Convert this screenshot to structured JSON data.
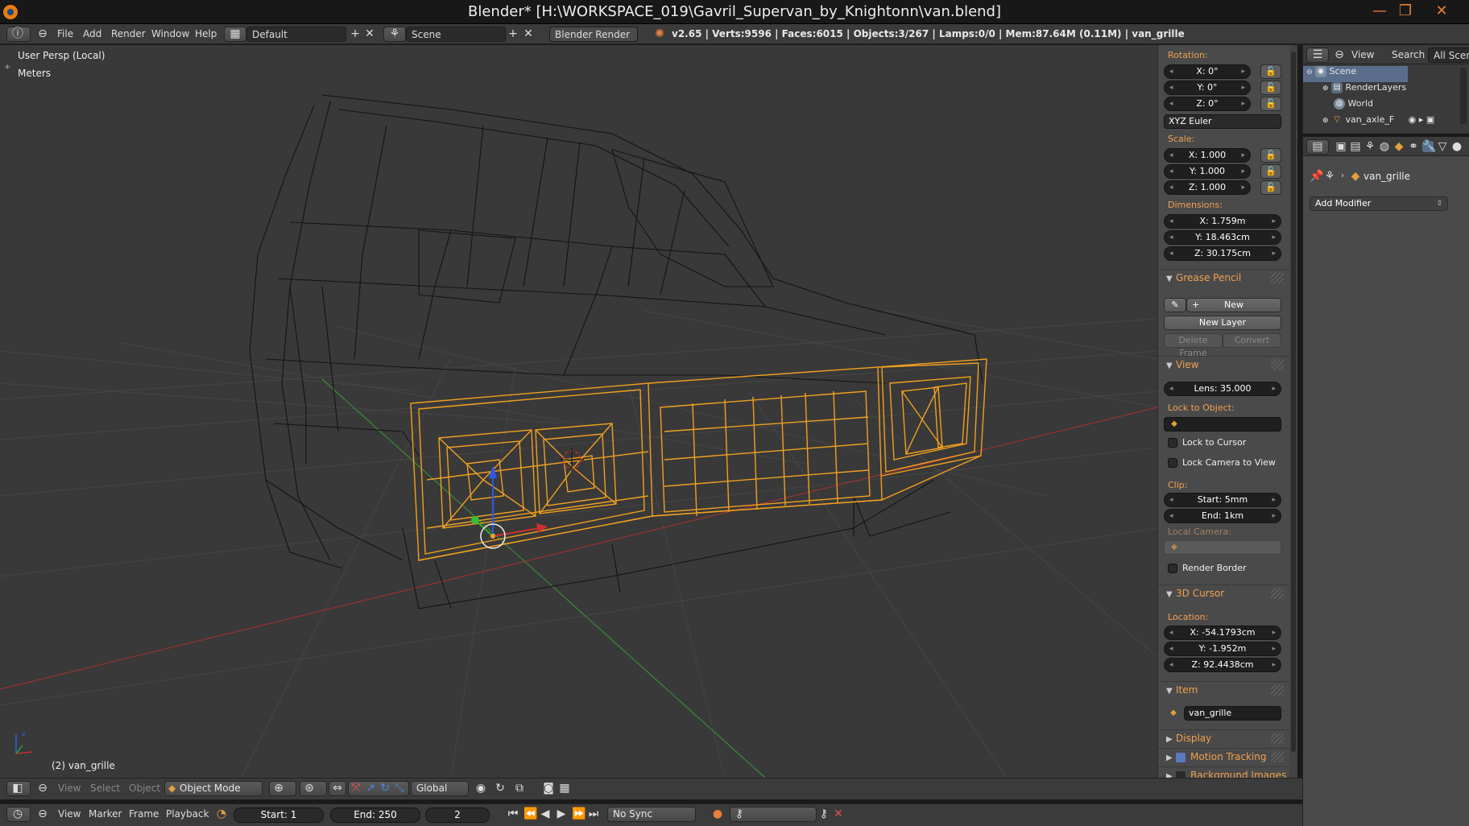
{
  "window": {
    "title": "Blender* [H:\\WORKSPACE_019\\Gavril_Supervan_by_Knightonn\\van.blend]",
    "minimize": "—",
    "maximize": "❐",
    "close": "✕"
  },
  "infobar": {
    "menus": [
      "File",
      "Add",
      "Render",
      "Window",
      "Help"
    ],
    "layout": "Default",
    "scene": "Scene",
    "engine": "Blender Render",
    "stats": "v2.65 | Verts:9596 | Faces:6015 | Objects:3/267 | Lamps:0/0 | Mem:87.64M (0.11M) | van_grille"
  },
  "viewport": {
    "view_name": "User Persp (Local)",
    "units": "Meters",
    "object_label": "(2) van_grille",
    "colors": {
      "selected": "#f0a020",
      "wire": "#111111",
      "grid": "#4a4a4a",
      "x_axis": "#a03030",
      "y_axis": "#3a8a3a"
    }
  },
  "npanel": {
    "rotation_label": "Rotation:",
    "rotation": [
      "X: 0°",
      "Y: 0°",
      "Z: 0°"
    ],
    "rotation_mode": "XYZ Euler",
    "scale_label": "Scale:",
    "scale": [
      "X: 1.000",
      "Y: 1.000",
      "Z: 1.000"
    ],
    "dimensions_label": "Dimensions:",
    "dimensions": [
      "X: 1.759m",
      "Y: 18.463cm",
      "Z: 30.175cm"
    ],
    "grease_pencil": {
      "header": "Grease Pencil",
      "new": "New",
      "new_layer": "New Layer",
      "delete_frame": "Delete Frame",
      "convert": "Convert"
    },
    "view": {
      "header": "View",
      "lens": "Lens: 35.000",
      "lock_to_object": "Lock to Object:",
      "lock_to_cursor": "Lock to Cursor",
      "lock_camera": "Lock Camera to View",
      "clip": "Clip:",
      "clip_start": "Start: 5mm",
      "clip_end": "End: 1km",
      "local_camera": "Local Camera:",
      "render_border": "Render Border"
    },
    "cursor": {
      "header": "3D Cursor",
      "location": "Location:",
      "x": "X: -54.1793cm",
      "y": "Y: -1.952m",
      "z": "Z: 92.4438cm"
    },
    "item": {
      "header": "Item",
      "name": "van_grille"
    },
    "display_header": "Display",
    "motion_tracking_header": "Motion Tracking",
    "background_images_header": "Background Images"
  },
  "outliner": {
    "view": "View",
    "search": "Search",
    "filter": "All Scenes",
    "rows": [
      "Scene",
      "RenderLayers",
      "World",
      "van_axle_F"
    ]
  },
  "properties": {
    "object_name": "van_grille",
    "add_modifier": "Add Modifier"
  },
  "viewport_header": {
    "menus": [
      "View",
      "Select",
      "Object"
    ],
    "mode": "Object Mode",
    "orientation": "Global"
  },
  "timeline": {
    "menus": [
      "View",
      "Marker",
      "Frame",
      "Playback"
    ],
    "start": "Start: 1",
    "end": "End: 250",
    "frame": "2",
    "sync": "No Sync"
  }
}
